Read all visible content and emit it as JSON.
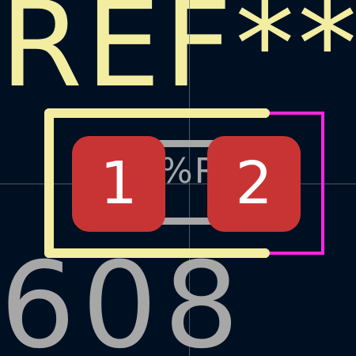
{
  "silkscreen": {
    "reference": "REF**"
  },
  "fabrication": {
    "value": "608_",
    "reference": "%R"
  },
  "pads": [
    {
      "number": "1"
    },
    {
      "number": "2"
    }
  ],
  "colors": {
    "background": "#001023",
    "silkscreen": "#f2eda1",
    "fabrication": "#a7a7a7",
    "courtyard": "#ff26e2",
    "pad": "#c83434",
    "pad_text": "#ffffff",
    "grid_crosshair": "#6f7680"
  },
  "icons": {
    "origin": "crosshair-icon"
  }
}
